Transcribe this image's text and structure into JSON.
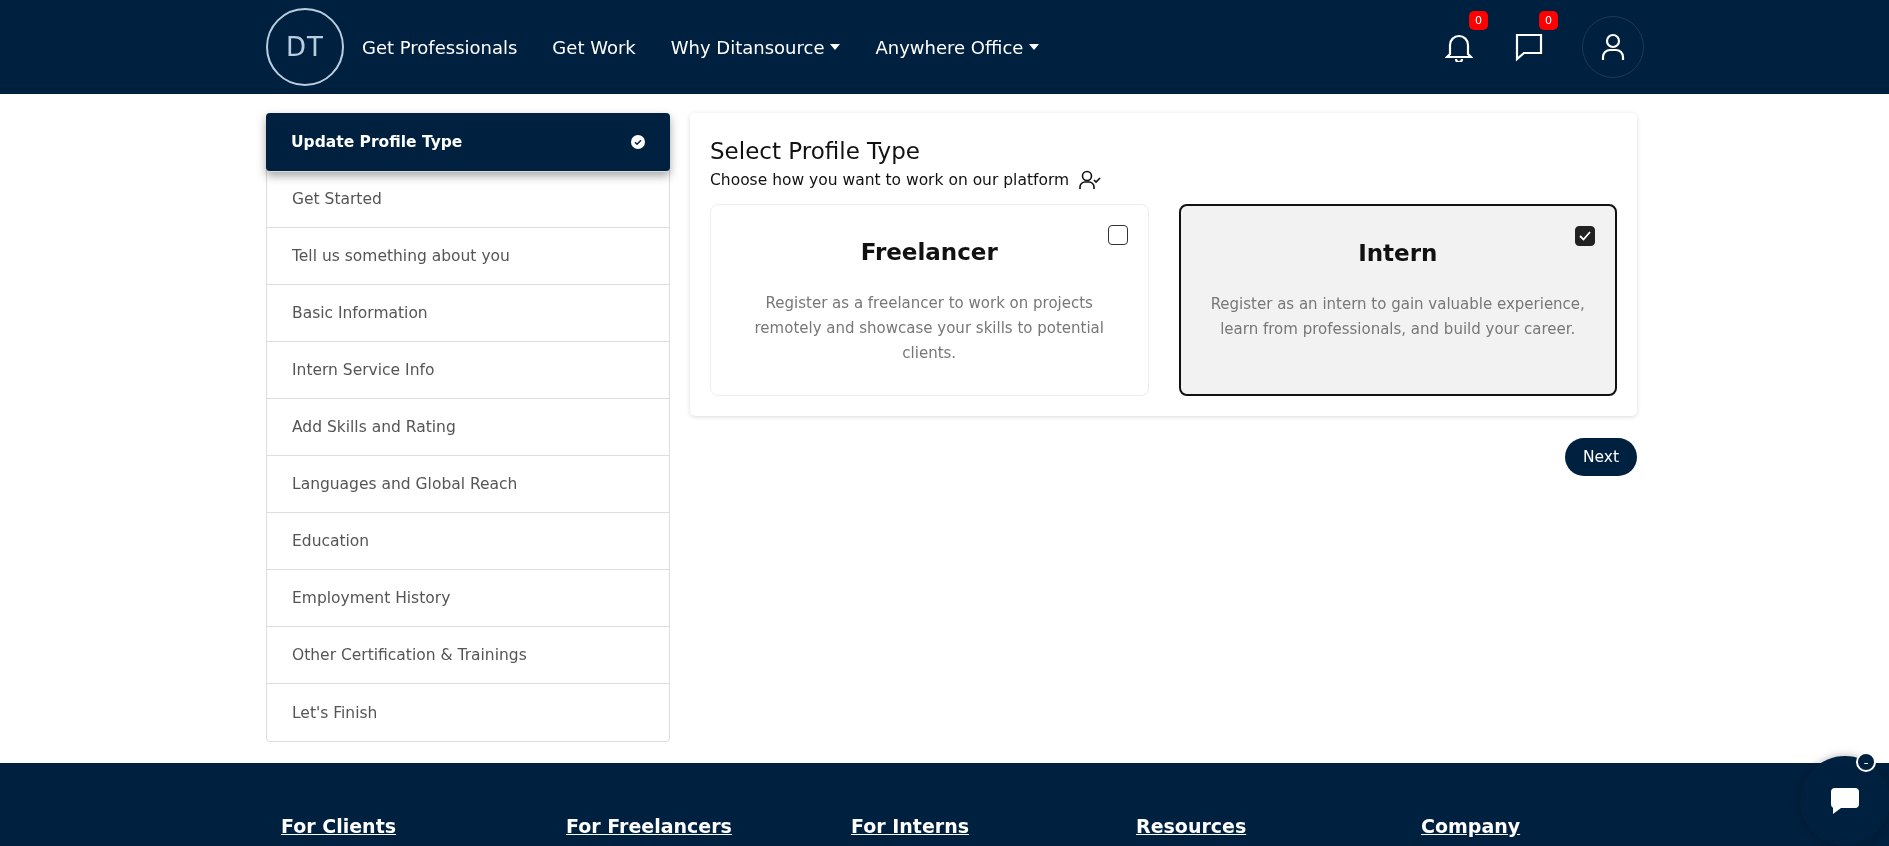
{
  "header": {
    "logo": "DT",
    "nav": [
      {
        "label": "Get Professionals",
        "dropdown": false
      },
      {
        "label": "Get Work",
        "dropdown": false
      },
      {
        "label": "Why Ditansource",
        "dropdown": true
      },
      {
        "label": "Anywhere Office",
        "dropdown": true
      }
    ],
    "notifications_count": "0",
    "messages_count": "0"
  },
  "sidebar": {
    "items": [
      {
        "label": "Update Profile Type",
        "selected": true,
        "done": true
      },
      {
        "label": "Get Started",
        "selected": false,
        "done": false
      },
      {
        "label": "Tell us something about you",
        "selected": false,
        "done": false
      },
      {
        "label": "Basic Information",
        "selected": false,
        "done": false
      },
      {
        "label": "Intern Service Info",
        "selected": false,
        "done": false
      },
      {
        "label": "Add Skills and Rating",
        "selected": false,
        "done": false
      },
      {
        "label": "Languages and Global Reach",
        "selected": false,
        "done": false
      },
      {
        "label": "Education",
        "selected": false,
        "done": false
      },
      {
        "label": "Employment History",
        "selected": false,
        "done": false
      },
      {
        "label": "Other Certification & Trainings",
        "selected": false,
        "done": false
      },
      {
        "label": "Let's Finish",
        "selected": false,
        "done": false
      }
    ]
  },
  "panel": {
    "title": "Select Profile Type",
    "subtitle": "Choose how you want to work on our platform",
    "options": [
      {
        "title": "Freelancer",
        "description": "Register as a freelancer to work on projects remotely and showcase your skills to potential clients.",
        "selected": false
      },
      {
        "title": "Intern",
        "description": "Register as an intern to gain valuable experience, learn from professionals, and build your career.",
        "selected": true
      }
    ],
    "next_button": "Next"
  },
  "footer": {
    "headings": [
      "For Clients",
      "For Freelancers",
      "For Interns",
      "Resources",
      "Company"
    ]
  },
  "chat_widget": {
    "badge": "-"
  }
}
